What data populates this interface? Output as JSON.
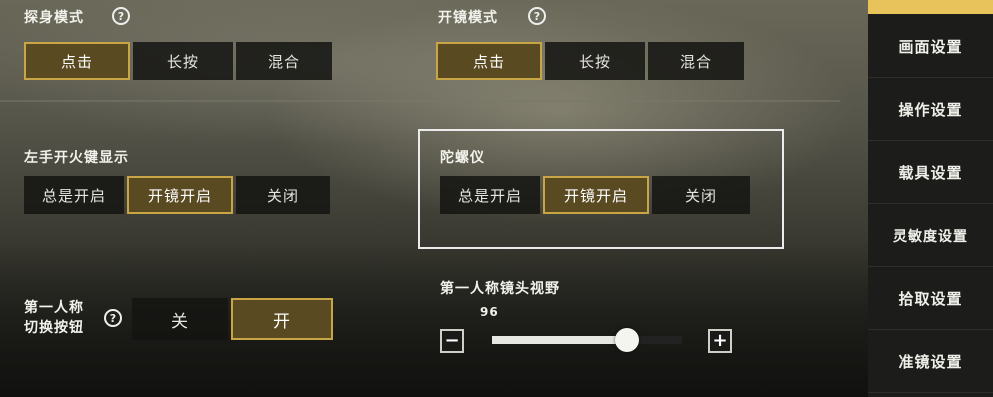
{
  "scope_mode": {
    "label": "探身模式",
    "options": [
      "点击",
      "长按",
      "混合"
    ],
    "selected_index": 0
  },
  "open_mirror_mode": {
    "label": "开镜模式",
    "options": [
      "点击",
      "长按",
      "混合"
    ],
    "selected_index": 0
  },
  "left_fire_button": {
    "label": "左手开火键显示",
    "options": [
      "总是开启",
      "开镜开启",
      "关闭"
    ],
    "selected_index": 1
  },
  "gyroscope": {
    "label": "陀螺仪",
    "options": [
      "总是开启",
      "开镜开启",
      "关闭"
    ],
    "selected_index": 1
  },
  "first_person_toggle": {
    "label_line1": "第一人称",
    "label_line2": "切换按钮",
    "options": [
      "关",
      "开"
    ],
    "selected_index": 1
  },
  "fov": {
    "label": "第一人称镜头视野",
    "value": "96",
    "fill_fraction": 0.71,
    "minus": "−",
    "plus": "+"
  },
  "help_glyph": "?",
  "sidebar": {
    "items": [
      "画面设置",
      "操作设置",
      "载具设置",
      "灵敏度设置",
      "拾取设置",
      "准镜设置"
    ]
  },
  "colors": {
    "selected_border": "#c8a545",
    "selected_fill": "#5a4a22",
    "sidebar_accent": "#e8c25a"
  }
}
